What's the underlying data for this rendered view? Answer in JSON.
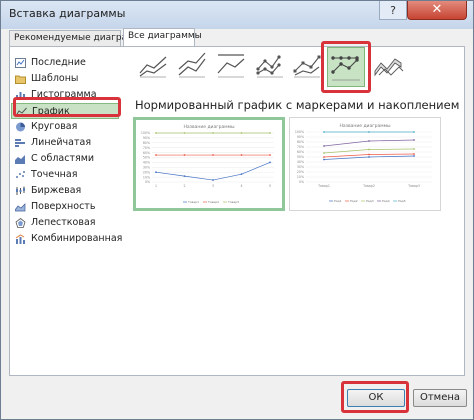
{
  "window": {
    "title": "Вставка диаграммы",
    "help": "?",
    "close": "✕"
  },
  "tabs": [
    {
      "label": "Рекомендуемые диаграммы",
      "selected": false
    },
    {
      "label": "Все диаграммы",
      "selected": true
    }
  ],
  "sidebar": {
    "items": [
      {
        "label": "Последние",
        "icon": "recent-icon"
      },
      {
        "label": "Шаблоны",
        "icon": "folder-icon"
      },
      {
        "label": "Гистограмма",
        "icon": "column-chart-icon"
      },
      {
        "label": "График",
        "icon": "line-chart-icon",
        "selected": true
      },
      {
        "label": "Круговая",
        "icon": "pie-chart-icon"
      },
      {
        "label": "Линейчатая",
        "icon": "bar-chart-icon"
      },
      {
        "label": "С областями",
        "icon": "area-chart-icon"
      },
      {
        "label": "Точечная",
        "icon": "scatter-chart-icon"
      },
      {
        "label": "Биржевая",
        "icon": "stock-chart-icon"
      },
      {
        "label": "Поверхность",
        "icon": "surface-chart-icon"
      },
      {
        "label": "Лепестковая",
        "icon": "radar-chart-icon"
      },
      {
        "label": "Комбинированная",
        "icon": "combo-chart-icon"
      }
    ]
  },
  "subtypes": [
    {
      "icon": "line-icon"
    },
    {
      "icon": "stacked-line-icon"
    },
    {
      "icon": "percent-stacked-line-icon"
    },
    {
      "icon": "line-markers-icon"
    },
    {
      "icon": "stacked-line-markers-icon"
    },
    {
      "icon": "percent-stacked-line-markers-icon",
      "selected": true
    },
    {
      "icon": "3d-line-icon"
    }
  ],
  "main": {
    "heading": "Нормированный график с маркерами и накоплением"
  },
  "previews": [
    {
      "title": "Название диаграммы",
      "y_ticks": [
        "100%",
        "90%",
        "80%",
        "70%",
        "60%",
        "50%",
        "40%",
        "30%",
        "20%",
        "10%",
        "0%"
      ],
      "x_ticks": [
        "1",
        "2",
        "3",
        "4",
        "5"
      ],
      "legend": [
        "Товар1",
        "Товар2",
        "Товар3"
      ],
      "colors": [
        "#4472c4",
        "#ed5a48",
        "#a5c26a"
      ]
    },
    {
      "title": "Название диаграммы",
      "y_ticks": [
        "100%",
        "90%",
        "80%",
        "70%",
        "60%",
        "50%",
        "40%",
        "30%",
        "20%",
        "10%",
        "0%"
      ],
      "x_ticks": [
        "Товар1",
        "Товар2",
        "Товар3"
      ],
      "legend": [
        "Ряд1",
        "Ряд2",
        "Ряд3",
        "Ряд4",
        "Ряд5"
      ],
      "colors": [
        "#4472c4",
        "#ed5a48",
        "#a5c26a",
        "#8064a2",
        "#4bacc6"
      ]
    }
  ],
  "buttons": {
    "ok": "ОК",
    "cancel": "Отмена"
  }
}
